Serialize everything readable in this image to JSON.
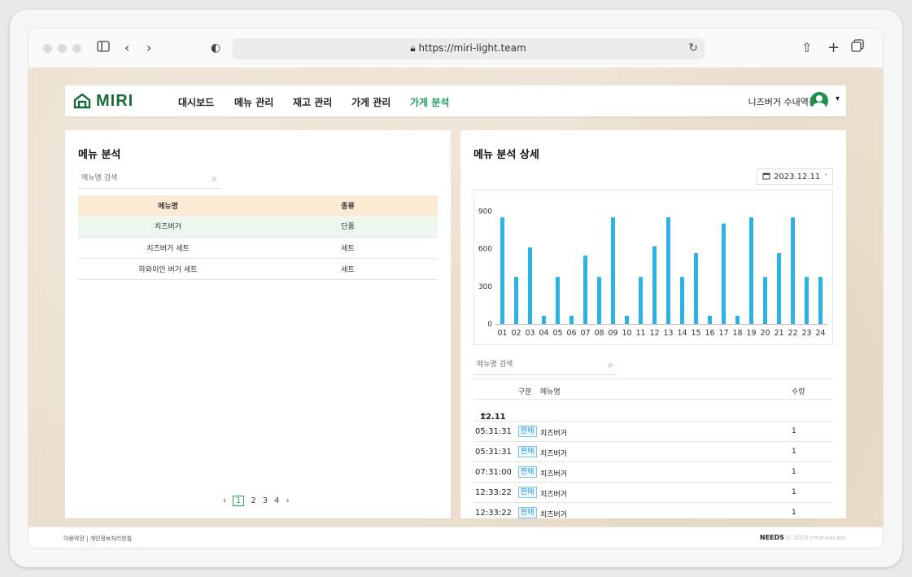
{
  "browser": {
    "url": "https://miri-light.team"
  },
  "nav": {
    "logo": "MIRI",
    "items": [
      "대시보드",
      "메뉴 관리",
      "재고 관리",
      "가게 관리",
      "가게 분석"
    ],
    "active_index": 4,
    "store_name": "니즈버거 수내역점",
    "accent_color": "#1d9c5c"
  },
  "left": {
    "title": "메뉴 분석",
    "search_placeholder": "메뉴명 검색",
    "columns": [
      "메뉴명",
      "종류"
    ],
    "rows": [
      {
        "name": "치즈버거",
        "type": "단품"
      },
      {
        "name": "치즈버거 세트",
        "type": "세트"
      },
      {
        "name": "하와이안 버거 세트",
        "type": "세트"
      }
    ],
    "pagination": {
      "prev": "‹",
      "pages": [
        "1",
        "2",
        "3",
        "4"
      ],
      "current": "1",
      "next": "›"
    }
  },
  "right": {
    "title": "메뉴 분석 상세",
    "date": "2023.12.11",
    "search_placeholder": "메뉴명 검색",
    "list_columns": {
      "type": "구분",
      "name": "메뉴명",
      "qty": "수량"
    },
    "group_label": "12.11",
    "records": [
      {
        "time": "05:31:31",
        "badge": "판매",
        "name": "치즈버거",
        "qty": "1"
      },
      {
        "time": "05:31:31",
        "badge": "판매",
        "name": "치즈버거",
        "qty": "1"
      },
      {
        "time": "07:31:00",
        "badge": "판매",
        "name": "치즈버거",
        "qty": "1"
      },
      {
        "time": "12:33:22",
        "badge": "판매",
        "name": "치즈버거",
        "qty": "1"
      },
      {
        "time": "12:33:22",
        "badge": "판매",
        "name": "치즈버거",
        "qty": "1"
      }
    ]
  },
  "chart_data": {
    "type": "bar",
    "categories": [
      "01",
      "02",
      "03",
      "04",
      "05",
      "06",
      "07",
      "08",
      "09",
      "10",
      "11",
      "12",
      "13",
      "14",
      "15",
      "16",
      "17",
      "18",
      "19",
      "20",
      "21",
      "22",
      "23",
      "24"
    ],
    "values": [
      850,
      375,
      610,
      65,
      375,
      65,
      545,
      375,
      850,
      65,
      375,
      620,
      850,
      375,
      565,
      65,
      800,
      65,
      850,
      375,
      565,
      850,
      375,
      375
    ],
    "yticks": [
      0,
      300,
      600,
      900
    ],
    "ylim": [
      0,
      1000
    ],
    "bar_color": "#2cb3e6",
    "title": "",
    "xlabel": "",
    "ylabel": ""
  },
  "footer": {
    "links": "이용약관 | 개인정보처리방침",
    "brand": "NEEDS",
    "copyright": "© 2023 creativeLabs"
  }
}
